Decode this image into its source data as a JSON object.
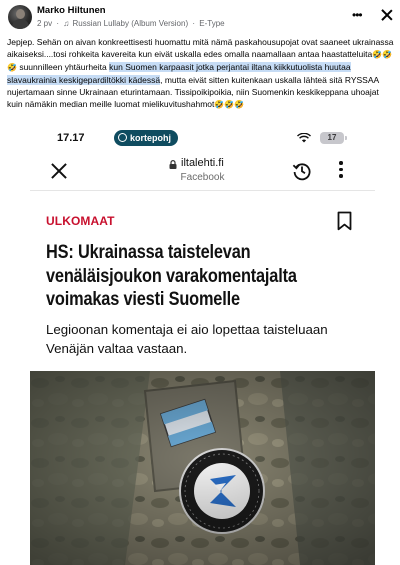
{
  "post": {
    "author": "Marko Hiltunen",
    "time": "2 pv",
    "song": "Russian Lullaby (Album Version)",
    "artist": "E-Type",
    "text_1": "Jepjep. Sehän on aivan konkreettisesti huomattu mitä nämä paskahousupojat ovat saaneet ukrainassa aikaiseksi....tosi rohkeita kavereita kun eivät uskalla edes omalla naamallaan antaa haastatteluita",
    "emoji_1": "🤣🤣🤣",
    "text_2": " suunnilleen yhtäurheita ",
    "highlight": "kun Suomen karpaasit jotka perjantai iltana kiikkutuolista huutaa slavaukrainia keskigepardiltökki kädessä",
    "text_3": ", mutta eivät sitten kuitenkaan uskalla lähteä sitä RYSSAA nujertamaan sinne Ukrainaan eturintamaan. Tissipoikipoikia, niin Suomenkin keskikeppana uhoajat kuin nämäkin median meille luomat mielikuvitushahmot",
    "emoji_2": "🤣🤣🤣"
  },
  "screenshot": {
    "status_bar": {
      "time": "17.17",
      "app_pill": "kortepohj",
      "battery": "17"
    },
    "browser": {
      "domain": "iltalehti.fi",
      "source": "Facebook"
    },
    "article": {
      "category": "ULKOMAAT",
      "headline": "HS: Ukrainassa taistelevan venäläisjoukon varakomentajalta voimakas viesti Suomelle",
      "lead": "Legioonan komentaja ei aio lopettaa taisteluaan Venäjän valtaa vastaan."
    },
    "photo": {
      "patch_text": "SVOBODA RUSSIAN VOLUNTEER LEGION",
      "patch_text_ru": "ЗАВИСИТ ОТ НАШЕЙ СВОБОДЫ"
    }
  }
}
